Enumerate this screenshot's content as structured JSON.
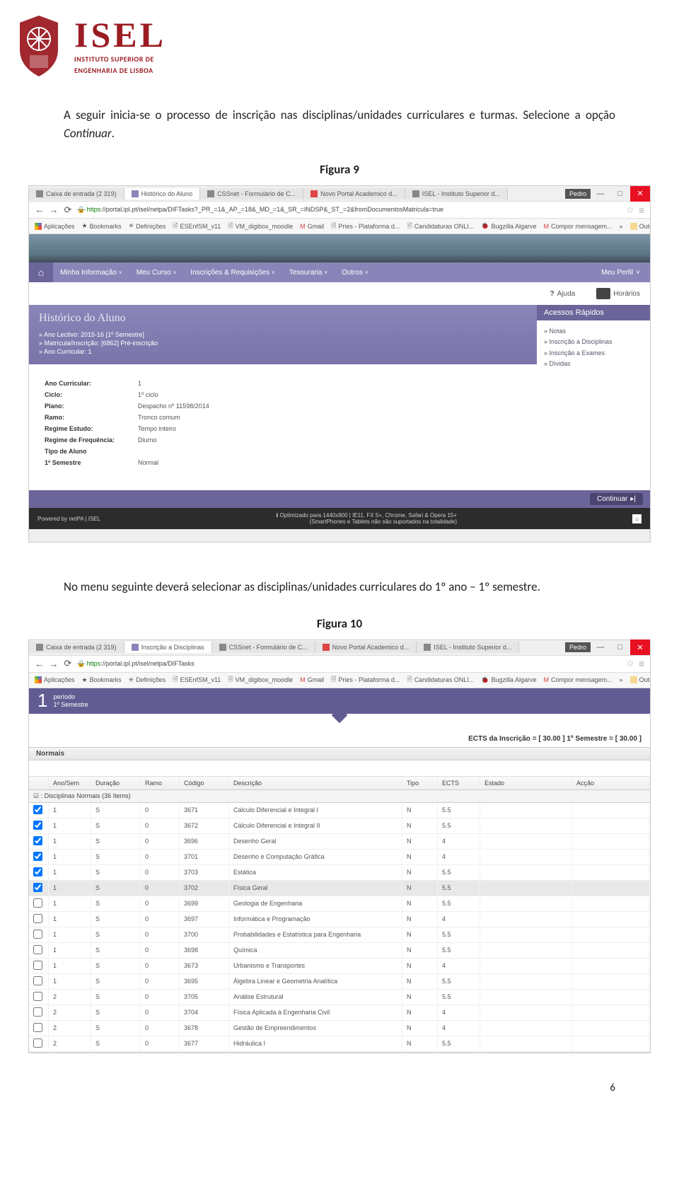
{
  "header": {
    "title_main": "ISEL",
    "subtitle_1": "INSTITUTO SUPERIOR DE",
    "subtitle_2": "ENGENHARIA DE LISBOA"
  },
  "paragraph1_a": "A seguir inicia-se o processo de inscrição nas disciplinas/unidades curriculares e turmas. Selecione a opção ",
  "paragraph1_b": "Continuar",
  "paragraph1_c": ".",
  "fig9": "Figura 9",
  "paragraph2": "No menu seguinte deverá selecionar as disciplinas/unidades curriculares do 1º ano – 1º semestre.",
  "fig10": "Figura 10",
  "page_number": "6",
  "chrome": {
    "tabs_s1": [
      "Caixa de entrada (2 319)",
      "Histórico do Aluno",
      "CSSnet - Formulário de C...",
      "Novo Portal Academico d...",
      "ISEL - Instituto Superior d..."
    ],
    "tabs_s2": [
      "Caixa de entrada (2 319)",
      "Inscrição a Disciplinas",
      "CSSnet - Formulário de C...",
      "Novo Portal Academico d...",
      "ISEL - Instituto Superior d..."
    ],
    "user": "Pedro",
    "url_s1": "://portal.ipl.pt/isel/netpa/DIFTasks?_PR_=1&_AP_=18&_MD_=1&_SR_=INDSP&_ST_=2&fromDocumentosMatricula=true",
    "url_s2": "://portal.ipl.pt/isel/netpa/DIFTasks",
    "https_prefix": "https",
    "bookmarks": [
      "Aplicações",
      "Bookmarks",
      "Definições",
      "ESEnfSM_v11",
      "VM_digibox_moodle",
      "Gmail",
      "Pries - Plataforma d...",
      "Candidaturas ONLI...",
      "Bugzilla Algarve",
      "Compor mensagem..."
    ],
    "bm_more": "»",
    "bm_other": "Outros marcadores"
  },
  "s1": {
    "menu": [
      "Minha Informação",
      "Meu Curso",
      "Inscrições & Requisições",
      "Tesouraria",
      "Outros"
    ],
    "menu_right": "Meu Perfil",
    "help": "Ajuda",
    "horarios": "Horários",
    "hist_title": "Histórico do Aluno",
    "hist_lines": [
      "» Ano Lectivo:  2015-16 [1º Semestre]",
      "» Matrícula/Inscrição:  [6862] Pré-inscrição",
      "» Ano Curricular:  1"
    ],
    "acessos_header": "Acessos Rápidos",
    "acessos_items": [
      "Notas",
      "Inscrição a Disciplinas",
      "Inscrição a Exames",
      "Dívidas"
    ],
    "details": [
      [
        "Ano Curricular:",
        "1"
      ],
      [
        "Ciclo:",
        "1º ciclo"
      ],
      [
        "Plano:",
        "Despacho nº 11598/2014"
      ],
      [
        "Ramo:",
        "Tronco comum"
      ],
      [
        "Regime Estudo:",
        "Tempo inteiro"
      ],
      [
        "Regime de Frequência:",
        "Diurno"
      ],
      [
        "Tipo de Aluno",
        ""
      ],
      [
        "1º Semestre",
        "Normal"
      ]
    ],
    "continue_btn": "Continuar",
    "footer_left": "Powered by   netPA | ISEL",
    "footer_r1": "Optimizado para 1440x900 | IE11, FX 5+, Chrome, Safari & Opera 15+",
    "footer_r2": "(SmartPhones e Tablets não são suportados na totalidade)"
  },
  "s2": {
    "period_num": "1",
    "period_label_a": "período",
    "period_label_b": "1º Semestre",
    "ects_text": "ECTS da Inscrição = [ 30.00 ] 1º Semestre = [ 30.00 ]",
    "normais_hd": "Normais",
    "columns": [
      "",
      "Ano/Sem",
      "Duração",
      "Ramo",
      "Código",
      "Descrição",
      "Tipo",
      "ECTS",
      "Estado",
      "Acção"
    ],
    "section_label": "☑ : Disciplinas Normais (36 Items)",
    "rows": [
      {
        "chk": true,
        "ano": "1",
        "dur": "S",
        "ramo": "0",
        "cod": "3671",
        "desc": "Cálculo Diferencial e Integral I",
        "tipo": "N",
        "ects": "5.5"
      },
      {
        "chk": true,
        "ano": "1",
        "dur": "S",
        "ramo": "0",
        "cod": "3672",
        "desc": "Cálculo Diferencial e Integral II",
        "tipo": "N",
        "ects": "5.5"
      },
      {
        "chk": true,
        "ano": "1",
        "dur": "S",
        "ramo": "0",
        "cod": "3696",
        "desc": "Desenho Geral",
        "tipo": "N",
        "ects": "4"
      },
      {
        "chk": true,
        "ano": "1",
        "dur": "S",
        "ramo": "0",
        "cod": "3701",
        "desc": "Desenho e Computação Gráfica",
        "tipo": "N",
        "ects": "4"
      },
      {
        "chk": true,
        "ano": "1",
        "dur": "S",
        "ramo": "0",
        "cod": "3703",
        "desc": "Estática",
        "tipo": "N",
        "ects": "5.5"
      },
      {
        "chk": true,
        "ano": "1",
        "dur": "S",
        "ramo": "0",
        "cod": "3702",
        "desc": "Física Geral",
        "tipo": "N",
        "ects": "5.5",
        "alt": true
      },
      {
        "chk": false,
        "ano": "1",
        "dur": "S",
        "ramo": "0",
        "cod": "3699",
        "desc": "Geologia de Engenharia",
        "tipo": "N",
        "ects": "5.5"
      },
      {
        "chk": false,
        "ano": "1",
        "dur": "S",
        "ramo": "0",
        "cod": "3697",
        "desc": "Informática e Programação",
        "tipo": "N",
        "ects": "4"
      },
      {
        "chk": false,
        "ano": "1",
        "dur": "S",
        "ramo": "0",
        "cod": "3700",
        "desc": "Probabilidades e Estatística para Engenharia",
        "tipo": "N",
        "ects": "5.5"
      },
      {
        "chk": false,
        "ano": "1",
        "dur": "S",
        "ramo": "0",
        "cod": "3698",
        "desc": "Química",
        "tipo": "N",
        "ects": "5.5"
      },
      {
        "chk": false,
        "ano": "1",
        "dur": "S",
        "ramo": "0",
        "cod": "3673",
        "desc": "Urbanismo e Transportes",
        "tipo": "N",
        "ects": "4"
      },
      {
        "chk": false,
        "ano": "1",
        "dur": "S",
        "ramo": "0",
        "cod": "3695",
        "desc": "Álgebra Linear e Geometria Analítica",
        "tipo": "N",
        "ects": "5.5"
      },
      {
        "chk": false,
        "ano": "2",
        "dur": "S",
        "ramo": "0",
        "cod": "3705",
        "desc": "Análise Estrutural",
        "tipo": "N",
        "ects": "5.5"
      },
      {
        "chk": false,
        "ano": "2",
        "dur": "S",
        "ramo": "0",
        "cod": "3704",
        "desc": "Física Aplicada à Engenharia Civil",
        "tipo": "N",
        "ects": "4"
      },
      {
        "chk": false,
        "ano": "2",
        "dur": "S",
        "ramo": "0",
        "cod": "3678",
        "desc": "Gestão de Empreendimentos",
        "tipo": "N",
        "ects": "4"
      },
      {
        "chk": false,
        "ano": "2",
        "dur": "S",
        "ramo": "0",
        "cod": "3677",
        "desc": "Hidráulica I",
        "tipo": "N",
        "ects": "5.5"
      }
    ]
  }
}
